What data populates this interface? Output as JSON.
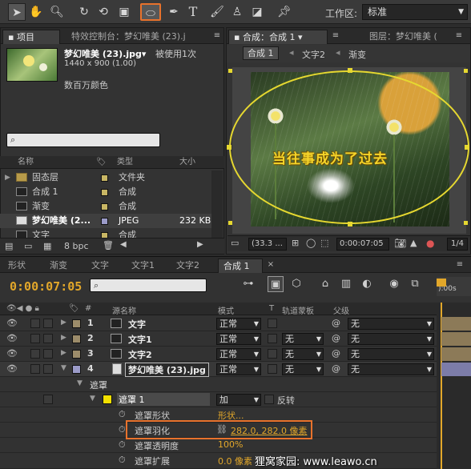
{
  "toolbar": {
    "workspace_label": "工作区:",
    "workspace_value": "标准",
    "tools": [
      "selection-tool-icon",
      "hand-tool-icon",
      "zoom-tool-icon",
      "rotate-tool-icon",
      "camera-orbit-icon",
      "pan-behind-icon",
      "ellipse-mask-tool-icon",
      "pen-tool-icon",
      "type-tool-icon",
      "brush-tool-icon",
      "clone-stamp-icon",
      "eraser-icon",
      "puppet-pin-icon"
    ]
  },
  "project_panel": {
    "tab_project": "项目",
    "tab_effects": "特效控制台：梦幻唯美 (23).j",
    "item_name": "梦幻唯美 (23).jpg▾",
    "item_usage": "被使用1次",
    "item_size": "1440 x 900 (1.00)",
    "item_color": "数百万颜色",
    "columns": {
      "name": "名称",
      "type": "类型",
      "size": "大小"
    },
    "rows": [
      {
        "name": "固态层",
        "type": "文件夹",
        "size": "",
        "color": "#c8b664"
      },
      {
        "name": "合成 1",
        "type": "合成",
        "size": "",
        "color": "#c8b664"
      },
      {
        "name": "渐变",
        "type": "合成",
        "size": "",
        "color": "#c8b664"
      },
      {
        "name": "梦幻唯美 (2...",
        "type": "JPEG",
        "size": "232 KB",
        "color": "#9b9bc8"
      },
      {
        "name": "文字",
        "type": "合成",
        "size": "",
        "color": "#c8b664"
      }
    ],
    "bpc": "8 bpc"
  },
  "composition_panel": {
    "tab_comp": "合成：合成 1",
    "tab_layer": "图层：梦幻唯美 (",
    "nav": [
      "合成 1",
      "文字2",
      "渐变"
    ],
    "overlay_text": "当往事成为了过去",
    "zoom": "(33.3 ...",
    "timecode": "0:00:07:05",
    "resolution": "1/4"
  },
  "timeline": {
    "tabs": [
      "形状",
      "渐变",
      "文字",
      "文字1",
      "文字2",
      "合成 1"
    ],
    "timecode": "0:00:07:05",
    "ruler_label": "):00s",
    "columns": {
      "source": "源名称",
      "mode": "模式",
      "t": "T",
      "trkmat": "轨道蒙板",
      "parent": "父级"
    },
    "layers": [
      {
        "num": "1",
        "name": "文字",
        "mode": "正常",
        "trkmat": "",
        "parent": "无",
        "color": "#9c8c6a"
      },
      {
        "num": "2",
        "name": "文字1",
        "mode": "正常",
        "trkmat": "无",
        "parent": "无",
        "color": "#9c8c6a"
      },
      {
        "num": "3",
        "name": "文字2",
        "mode": "正常",
        "trkmat": "无",
        "parent": "无",
        "color": "#9c8c6a"
      },
      {
        "num": "4",
        "name": "梦幻唯美 (23).jpg",
        "mode": "正常",
        "trkmat": "无",
        "parent": "无",
        "color": "#9b9bc8"
      }
    ],
    "masks_group": "遮罩",
    "mask_name": "遮罩 1",
    "mask_mode": "加",
    "mask_invert": "反转",
    "props": [
      {
        "label": "遮罩形状",
        "value": "形状..."
      },
      {
        "label": "遮罩羽化",
        "value": "282.0, 282.0 像素"
      },
      {
        "label": "遮罩透明度",
        "value": "100%"
      },
      {
        "label": "遮罩扩展",
        "value": "0.0 像素"
      }
    ]
  },
  "watermark": "狸窝家园: www.leawo.cn",
  "colors": {
    "accent": "#e2a72a",
    "highlight": "#e8722c",
    "mask": "#e6d830"
  }
}
